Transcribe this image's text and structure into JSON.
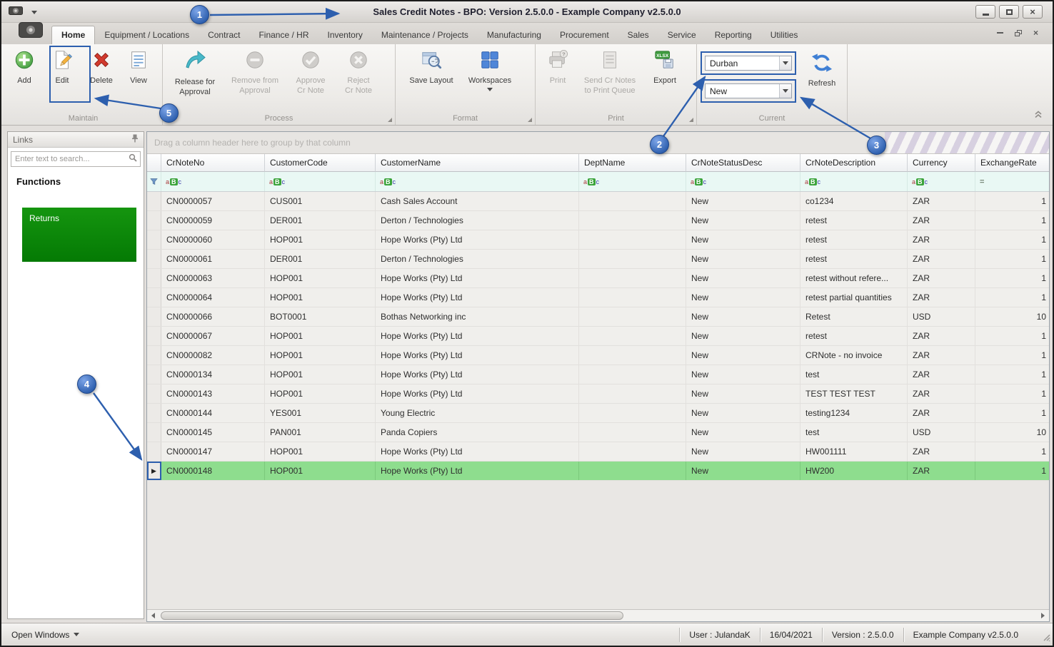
{
  "titlebar": {
    "title": "Sales Credit Notes - BPO: Version 2.5.0.0 - Example Company v2.5.0.0"
  },
  "tabs": [
    {
      "label": "Home",
      "active": true
    },
    {
      "label": "Equipment / Locations"
    },
    {
      "label": "Contract"
    },
    {
      "label": "Finance / HR"
    },
    {
      "label": "Inventory"
    },
    {
      "label": "Maintenance / Projects"
    },
    {
      "label": "Manufacturing"
    },
    {
      "label": "Procurement"
    },
    {
      "label": "Sales"
    },
    {
      "label": "Service"
    },
    {
      "label": "Reporting"
    },
    {
      "label": "Utilities"
    }
  ],
  "ribbon": {
    "maintain": {
      "label": "Maintain",
      "add": "Add",
      "edit": "Edit",
      "delete": "Delete",
      "view": "View"
    },
    "process": {
      "label": "Process",
      "release": "Release for\nApproval",
      "remove": "Remove from\nApproval",
      "approve": "Approve\nCr Note",
      "reject": "Reject\nCr Note"
    },
    "format": {
      "label": "Format",
      "save_layout": "Save Layout",
      "workspaces": "Workspaces"
    },
    "print": {
      "label": "Print",
      "print": "Print",
      "send": "Send Cr Notes\nto Print Queue",
      "export": "Export"
    },
    "current": {
      "label": "Current",
      "site_value": "Durban",
      "status_value": "New",
      "refresh": "Refresh"
    }
  },
  "sidebar": {
    "panel_title": "Links",
    "search_placeholder": "Enter text to search...",
    "functions_title": "Functions",
    "returns_label": "Returns"
  },
  "grid": {
    "group_hint": "Drag a column header here to group by that column",
    "columns": [
      "CrNoteNo",
      "CustomerCode",
      "CustomerName",
      "DeptName",
      "CrNoteStatusDesc",
      "CrNoteDescription",
      "Currency",
      "ExchangeRate"
    ],
    "filter_types": [
      "abc",
      "abc",
      "abc",
      "abc",
      "abc",
      "abc",
      "abc",
      "eq"
    ],
    "selected_index": 14,
    "rows": [
      [
        "CN0000057",
        "CUS001",
        "Cash Sales Account",
        "",
        "New",
        "co1234",
        "ZAR",
        "1"
      ],
      [
        "CN0000059",
        "DER001",
        "Derton / Technologies",
        "",
        "New",
        "retest",
        "ZAR",
        "1"
      ],
      [
        "CN0000060",
        "HOP001",
        "Hope Works (Pty) Ltd",
        "",
        "New",
        "retest",
        "ZAR",
        "1"
      ],
      [
        "CN0000061",
        "DER001",
        "Derton / Technologies",
        "",
        "New",
        "retest",
        "ZAR",
        "1"
      ],
      [
        "CN0000063",
        "HOP001",
        "Hope Works (Pty) Ltd",
        "",
        "New",
        "retest without refere...",
        "ZAR",
        "1"
      ],
      [
        "CN0000064",
        "HOP001",
        "Hope Works (Pty) Ltd",
        "",
        "New",
        "retest partial quantities",
        "ZAR",
        "1"
      ],
      [
        "CN0000066",
        "BOT0001",
        "Bothas Networking inc",
        "",
        "New",
        "Retest",
        "USD",
        "10"
      ],
      [
        "CN0000067",
        "HOP001",
        "Hope Works (Pty) Ltd",
        "",
        "New",
        "retest",
        "ZAR",
        "1"
      ],
      [
        "CN0000082",
        "HOP001",
        "Hope Works (Pty) Ltd",
        "",
        "New",
        "CRNote - no invoice",
        "ZAR",
        "1"
      ],
      [
        "CN0000134",
        "HOP001",
        "Hope Works (Pty) Ltd",
        "",
        "New",
        "test",
        "ZAR",
        "1"
      ],
      [
        "CN0000143",
        "HOP001",
        "Hope Works (Pty) Ltd",
        "",
        "New",
        "TEST TEST TEST",
        "ZAR",
        "1"
      ],
      [
        "CN0000144",
        "YES001",
        "Young Electric",
        "",
        "New",
        "testing1234",
        "ZAR",
        "1"
      ],
      [
        "CN0000145",
        "PAN001",
        "Panda Copiers",
        "",
        "New",
        "test",
        "USD",
        "10"
      ],
      [
        "CN0000147",
        "HOP001",
        "Hope Works (Pty) Ltd",
        "",
        "New",
        "HW001111",
        "ZAR",
        "1"
      ],
      [
        "CN0000148",
        "HOP001",
        "Hope Works (Pty) Ltd",
        "",
        "New",
        "HW200",
        "ZAR",
        "1"
      ]
    ]
  },
  "statusbar": {
    "open_windows": "Open Windows",
    "user": "User : JulandaK",
    "date": "16/04/2021",
    "version": "Version : 2.5.0.0",
    "company": "Example Company v2.5.0.0"
  },
  "annotations": [
    "1",
    "2",
    "3",
    "4",
    "5"
  ],
  "colors": {
    "annotation_blue": "#2d5fae",
    "selected_row_green": "#8edd8e",
    "returns_green": "#0a850a",
    "filter_row_mint": "#e9f8f4"
  }
}
